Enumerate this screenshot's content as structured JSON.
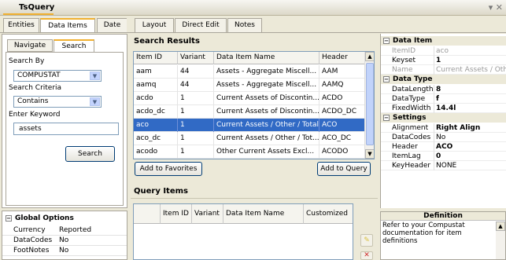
{
  "window": {
    "title": "TsQuery",
    "controls": "▾ ✕"
  },
  "main_tabs": [
    "Entities",
    "Data Items",
    "Date",
    "Layout",
    "Direct Edit",
    "Notes"
  ],
  "search_panel": {
    "tabs": [
      "Navigate",
      "Search"
    ],
    "search_by_label": "Search By",
    "search_by_value": "COMPUSTAT",
    "criteria_label": "Search Criteria",
    "criteria_value": "Contains",
    "keyword_label": "Enter Keyword",
    "keyword_value": "assets",
    "search_button": "Search"
  },
  "global_options": {
    "title": "Global Options",
    "rows": [
      {
        "key": "Currency",
        "value": "Reported"
      },
      {
        "key": "DataCodes",
        "value": "No"
      },
      {
        "key": "FootNotes",
        "value": "No"
      }
    ]
  },
  "search_results": {
    "title": "Search Results",
    "columns": [
      "Item ID",
      "Variant",
      "Data Item Name",
      "Header"
    ],
    "rows": [
      {
        "id": "aam",
        "variant": "44",
        "name": "Assets - Aggregate Miscell...",
        "header": "AAM"
      },
      {
        "id": "aamq",
        "variant": "44",
        "name": "Assets - Aggregate Miscell...",
        "header": "AAMQ"
      },
      {
        "id": "acdo",
        "variant": "1",
        "name": "Current Assets of Discontin...",
        "header": "ACDO"
      },
      {
        "id": "acdo_dc",
        "variant": "1",
        "name": "Current Assets of Discontin...",
        "header": "ACDO_DC"
      },
      {
        "id": "aco",
        "variant": "1",
        "name": "Current Assets / Other / Total",
        "header": "ACO"
      },
      {
        "id": "aco_dc",
        "variant": "1",
        "name": "Current Assets / Other / Tot...",
        "header": "ACO_DC"
      },
      {
        "id": "acodo",
        "variant": "1",
        "name": "Other Current Assets Excl...",
        "header": "ACODO"
      }
    ],
    "selected_index": 4,
    "add_favorites": "Add to Favorites",
    "add_query": "Add to Query"
  },
  "query_items": {
    "title": "Query Items",
    "columns": [
      "Item ID",
      "Variant",
      "Data Item Name",
      "Customized"
    ]
  },
  "properties": {
    "sections": [
      {
        "title": "Data Item",
        "rows": [
          {
            "key": "ItemID",
            "value": "aco",
            "gray": true
          },
          {
            "key": "Keyset",
            "value": "1",
            "bold": true
          },
          {
            "key": "Name",
            "value": "Current Assets / Oth",
            "gray": true
          }
        ]
      },
      {
        "title": "Data Type",
        "rows": [
          {
            "key": "DataLength",
            "value": "8",
            "bold": true
          },
          {
            "key": "DataType",
            "value": "f",
            "bold": true
          },
          {
            "key": "FixedWidth",
            "value": "14.4l",
            "bold": true
          }
        ]
      },
      {
        "title": "Settings",
        "rows": [
          {
            "key": "Alignment",
            "value": "Right Align",
            "bold": true
          },
          {
            "key": "DataCodes",
            "value": "No"
          },
          {
            "key": "Header",
            "value": "ACO",
            "bold": true
          },
          {
            "key": "ItemLag",
            "value": "0",
            "bold": true
          },
          {
            "key": "KeyHeader",
            "value": "NONE"
          }
        ]
      }
    ]
  },
  "definition": {
    "title": "Definition",
    "text": "Refer to your Compustat documentation for item definitions"
  },
  "colors": {
    "selection": "#316ac5",
    "tab_accent": "#f0b030"
  }
}
